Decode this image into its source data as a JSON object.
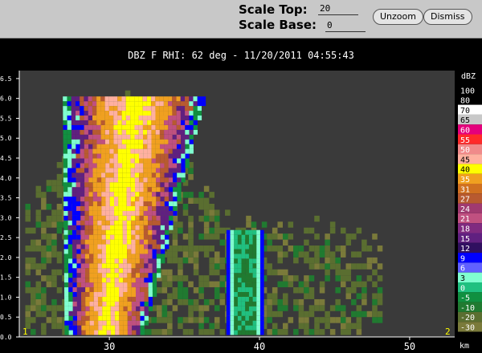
{
  "toolbar": {
    "scale_top_label": "Scale Top:",
    "scale_top_value": "20",
    "scale_base_label": "Scale Base:",
    "scale_base_value": "0",
    "unzoom_label": "Unzoom",
    "dismiss_label": "Dismiss"
  },
  "plot_title": "DBZ F  RHI: 62 deg  -  11/20/2011 04:55:43",
  "colors": {
    "background": "#3a3a3a",
    "toolbar": "#c8c8c8"
  },
  "chart_data": {
    "type": "heatmap",
    "title": "DBZ F  RHI: 62 deg  -  11/20/2011 04:55:43",
    "x": {
      "unit": "km",
      "ticks": [
        30,
        40,
        50
      ],
      "range": [
        24,
        53
      ]
    },
    "y": {
      "ticks": [
        "6.5",
        "6.0",
        "5.5",
        "5.0",
        "4.5",
        "4.0",
        "3.5",
        "3.0",
        "2.5",
        "2.0",
        "1.5",
        "1.0",
        "0.5",
        "0.0"
      ],
      "range": [
        0,
        6.7
      ]
    },
    "markers": {
      "left": "1",
      "right": "2"
    },
    "legend": {
      "unit": "dBZ",
      "levels": [
        {
          "label": "100",
          "color": "#000000"
        },
        {
          "label": "80",
          "color": "#000000"
        },
        {
          "label": "70",
          "color": "#ffffff"
        },
        {
          "label": "65",
          "color": "#c8c8c8"
        },
        {
          "label": "60",
          "color": "#e4007c"
        },
        {
          "label": "55",
          "color": "#ff2a2a"
        },
        {
          "label": "50",
          "color": "#f08a8a"
        },
        {
          "label": "45",
          "color": "#ffb0a0"
        },
        {
          "label": "40",
          "color": "#ffff00"
        },
        {
          "label": "35",
          "color": "#f0a020"
        },
        {
          "label": "31",
          "color": "#d07020"
        },
        {
          "label": "27",
          "color": "#b85a30"
        },
        {
          "label": "24",
          "color": "#a03a70"
        },
        {
          "label": "21",
          "color": "#c05080"
        },
        {
          "label": "18",
          "color": "#802a80"
        },
        {
          "label": "15",
          "color": "#602080"
        },
        {
          "label": "12",
          "color": "#301060"
        },
        {
          "label": "9",
          "color": "#0000ff"
        },
        {
          "label": "6",
          "color": "#6060ff"
        },
        {
          "label": "3",
          "color": "#80ffd0"
        },
        {
          "label": "0",
          "color": "#20c080"
        },
        {
          "label": "-5",
          "color": "#109040"
        },
        {
          "label": "-10",
          "color": "#207a30"
        },
        {
          "label": "-20",
          "color": "#5a6e30"
        },
        {
          "label": "-30",
          "color": "#7a7a3a"
        }
      ]
    }
  }
}
